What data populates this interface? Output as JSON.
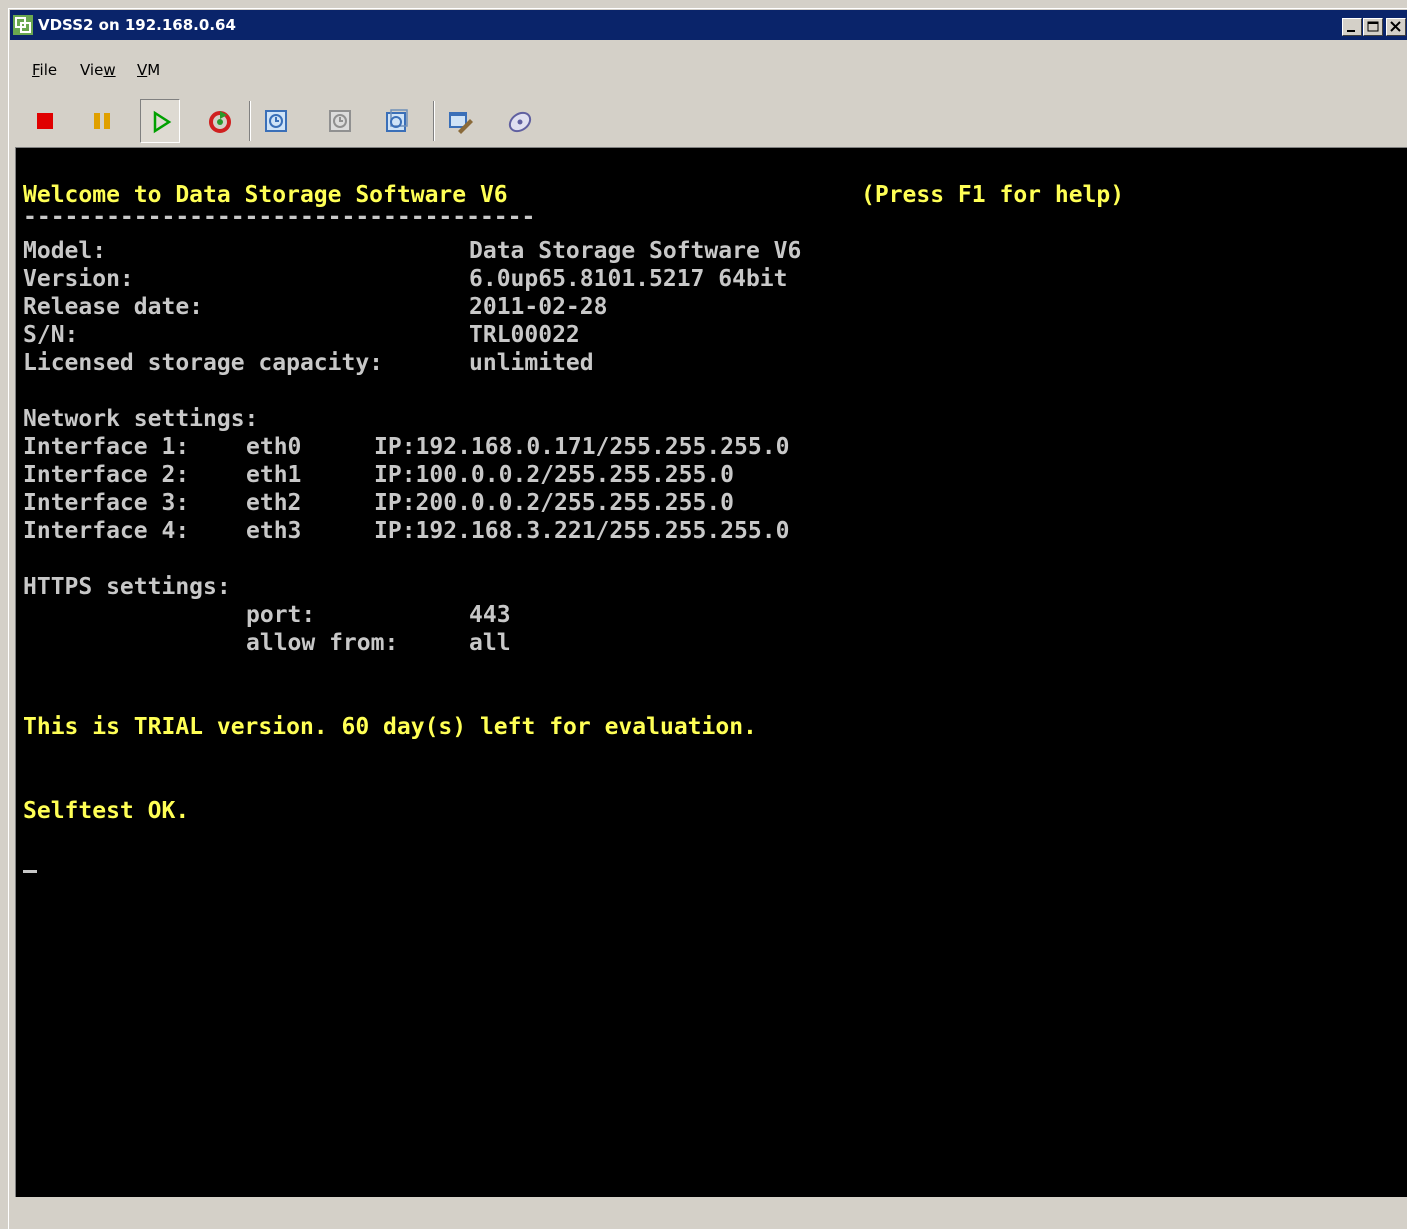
{
  "window": {
    "title": "VDSS2 on 192.168.0.64",
    "icon": "vmware-console-icon",
    "controls": [
      "minimize-icon",
      "maximize-icon",
      "close-icon"
    ]
  },
  "menu": [
    {
      "label": "File",
      "mnemonic": "F"
    },
    {
      "label": "View",
      "mnemonic": "w"
    },
    {
      "label": "VM",
      "mnemonic": "V"
    }
  ],
  "toolbar": [
    {
      "icon": "stop-icon",
      "color": "#e00000"
    },
    {
      "icon": "pause-icon",
      "color": "#e0a000"
    },
    {
      "icon": "play-icon",
      "color": "#00a000",
      "pressed": true
    },
    {
      "icon": "reset-icon",
      "color": "#d02020"
    },
    {
      "icon": "snapshot-take-icon"
    },
    {
      "icon": "snapshot-revert-icon"
    },
    {
      "icon": "snapshot-manager-icon"
    },
    {
      "icon": "edit-settings-icon"
    },
    {
      "icon": "cd-dvd-icon"
    }
  ],
  "console": {
    "colors": {
      "text": "#c8c8c8",
      "highlight": "#ffff55",
      "background": "#000000"
    },
    "header": {
      "welcome": "Welcome to Data Storage Software V6",
      "help": "(Press F1 for help)",
      "rule": "-------------------------------------"
    },
    "info": [
      {
        "label": "Model:",
        "value": "Data Storage Software V6"
      },
      {
        "label": "Version:",
        "value": "6.0up65.8101.5217 64bit"
      },
      {
        "label": "Release date:",
        "value": "2011-02-28"
      },
      {
        "label": "S/N:",
        "value": "TRL00022"
      },
      {
        "label": "Licensed storage capacity:",
        "value": "unlimited"
      }
    ],
    "network": {
      "heading": "Network settings:",
      "interfaces": [
        {
          "name": "Interface 1:",
          "dev": "eth0",
          "ip": "IP:192.168.0.171/255.255.255.0"
        },
        {
          "name": "Interface 2:",
          "dev": "eth1",
          "ip": "IP:100.0.0.2/255.255.255.0"
        },
        {
          "name": "Interface 3:",
          "dev": "eth2",
          "ip": "IP:200.0.0.2/255.255.255.0"
        },
        {
          "name": "Interface 4:",
          "dev": "eth3",
          "ip": "IP:192.168.3.221/255.255.255.0"
        }
      ]
    },
    "https": {
      "heading": "HTTPS settings:",
      "port_label": "port:",
      "port": "443",
      "allow_label": "allow from:",
      "allow": "all"
    },
    "trial": "This is TRIAL version. 60 day(s) left for evaluation.",
    "selftest": "Selftest OK.",
    "cursor": "_"
  }
}
